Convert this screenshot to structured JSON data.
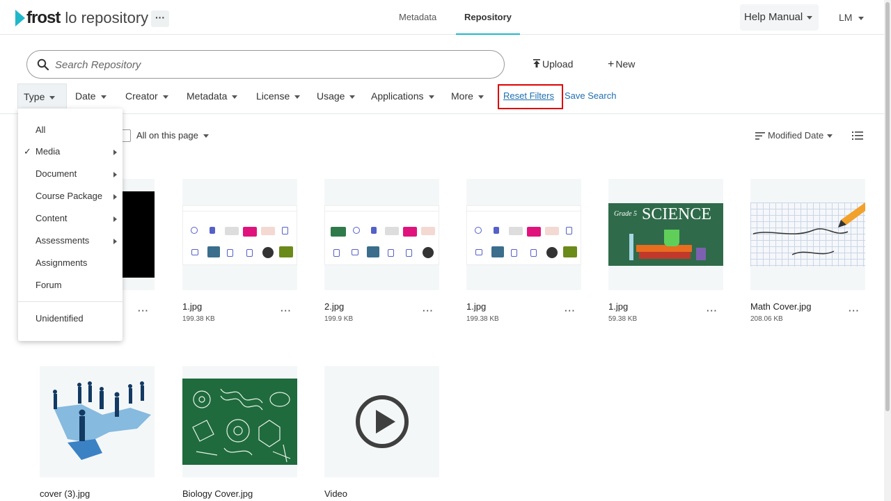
{
  "header": {
    "logo_word": "frost",
    "logo_sub": "lo repository",
    "more_label": "···",
    "tabs": [
      {
        "label": "Metadata"
      },
      {
        "label": "Repository"
      }
    ],
    "help_label": "Help Manual",
    "user_initials": "LM"
  },
  "search": {
    "placeholder": "Search Repository"
  },
  "actions": {
    "upload_label": "Upload",
    "new_label": "New"
  },
  "filters": {
    "items": [
      {
        "label": "Type"
      },
      {
        "label": "Date"
      },
      {
        "label": "Creator"
      },
      {
        "label": "Metadata"
      },
      {
        "label": "License"
      },
      {
        "label": "Usage"
      },
      {
        "label": "Applications"
      },
      {
        "label": "More"
      }
    ],
    "reset_label": "Reset Filters",
    "save_label": "Save Search"
  },
  "toolbar": {
    "select_label": "All on this page",
    "sort_label": "Modified Date"
  },
  "type_menu": {
    "items": [
      {
        "label": "All",
        "checked": false,
        "submenu": false
      },
      {
        "label": "Media",
        "checked": true,
        "submenu": true
      },
      {
        "label": "Document",
        "checked": false,
        "submenu": true
      },
      {
        "label": "Course Package",
        "checked": false,
        "submenu": true
      },
      {
        "label": "Content",
        "checked": false,
        "submenu": true
      },
      {
        "label": "Assessments",
        "checked": false,
        "submenu": true
      },
      {
        "label": "Assignments",
        "checked": false,
        "submenu": false
      },
      {
        "label": "Forum",
        "checked": false,
        "submenu": false
      },
      {
        "label": "Unidentified",
        "checked": false,
        "submenu": false
      }
    ],
    "check_glyph": "✓"
  },
  "cards": [
    {
      "name": "",
      "size": "",
      "thumb": "black"
    },
    {
      "name": "1.jpg",
      "size": "199.38 KB",
      "thumb": "screenshot"
    },
    {
      "name": "2.jpg",
      "size": "199.9 KB",
      "thumb": "screenshot"
    },
    {
      "name": "1.jpg",
      "size": "199.38 KB",
      "thumb": "screenshot"
    },
    {
      "name": "1.jpg",
      "size": "59.38 KB",
      "thumb": "science"
    },
    {
      "name": "Math Cover.jpg",
      "size": "208.06 KB",
      "thumb": "math"
    },
    {
      "name": "cover (3).jpg",
      "size": "",
      "thumb": "business"
    },
    {
      "name": "Biology Cover.jpg",
      "size": "",
      "thumb": "biology"
    },
    {
      "name": "Video",
      "size": "",
      "thumb": "video"
    }
  ],
  "science_label": "SCIENCE",
  "science_grade": "Grade 5",
  "card_more": "···",
  "colors": {
    "accent": "#1fb8c9",
    "link": "#1e6fb0",
    "highlight": "#dd0000"
  }
}
